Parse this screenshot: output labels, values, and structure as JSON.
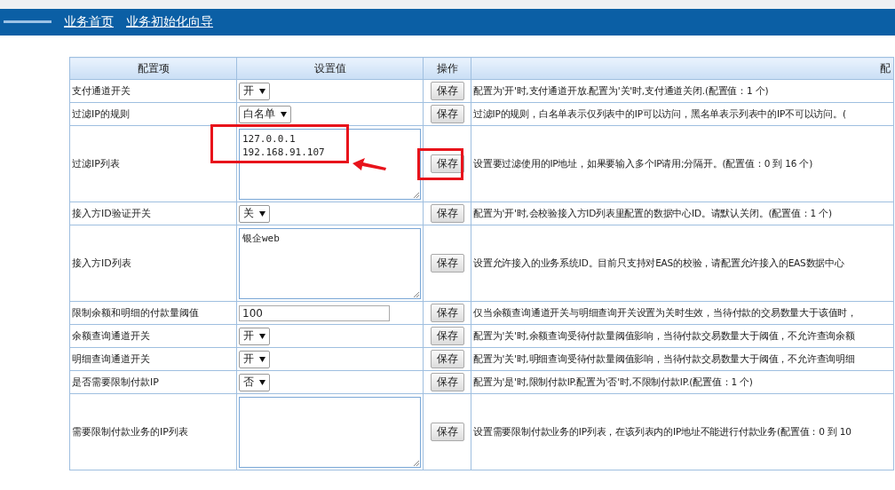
{
  "nav": {
    "links": [
      "业务首页",
      "业务初始化向导"
    ]
  },
  "table": {
    "columns": [
      "配置项",
      "设置值",
      "操作",
      "配"
    ],
    "rows": [
      {
        "name": "支付通道开关",
        "kind": "select",
        "value": "开",
        "button": "保存",
        "highlighted": false,
        "description": "配置为'开'时,支付通道开放.配置为'关'时,支付通道关闭.(配置值：1 个)"
      },
      {
        "name": "过滤IP的规则",
        "kind": "select",
        "value": "白名单",
        "button": "保存",
        "highlighted": false,
        "description": "过滤IP的规则，白名单表示仅列表中的IP可以访问，黑名单表示列表中的IP不可以访问。("
      },
      {
        "name": "过滤IP列表",
        "kind": "textarea",
        "value": "127.0.0.1\n192.168.91.107",
        "button": "保存",
        "highlighted": true,
        "description": "设置要过滤使用的IP地址，如果要输入多个IP请用;分隔开。(配置值：0 到 16 个)"
      },
      {
        "name": "接入方ID验证开关",
        "kind": "select",
        "value": "关",
        "button": "保存",
        "highlighted": false,
        "description": "配置为'开'时,会校验接入方ID列表里配置的数据中心ID。请默认关闭。(配置值：1 个)"
      },
      {
        "name": "接入方ID列表",
        "kind": "textarea",
        "value": "银企web",
        "button": "保存",
        "highlighted": false,
        "description": "设置允许接入的业务系统ID。目前只支持对EAS的校验，请配置允许接入的EAS数据中心"
      },
      {
        "name": "限制余额和明细的付款量阈值",
        "kind": "input",
        "value": "100",
        "button": "保存",
        "highlighted": false,
        "description": "仅当余额查询通道开关与明细查询开关设置为关时生效，当待付款的交易数量大于该值时，"
      },
      {
        "name": "余额查询通道开关",
        "kind": "select",
        "value": "开",
        "button": "保存",
        "highlighted": false,
        "description": "配置为'关'时,余额查询受待付款量阈值影响，当待付款交易数量大于阈值，不允许查询余额"
      },
      {
        "name": "明细查询通道开关",
        "kind": "select",
        "value": "开",
        "button": "保存",
        "highlighted": false,
        "description": "配置为'关'时,明细查询受待付款量阈值影响，当待付款交易数量大于阈值，不允许查询明细"
      },
      {
        "name": "是否需要限制付款IP",
        "kind": "select",
        "value": "否",
        "button": "保存",
        "highlighted": false,
        "description": "配置为'是'时,限制付款IP.配置为'否'时,不限制付款IP.(配置值：1 个)"
      },
      {
        "name": "需要限制付款业务的IP列表",
        "kind": "textarea",
        "value": "",
        "button": "保存",
        "highlighted": false,
        "description": "设置需要限制付款业务的IP列表，在该列表内的IP地址不能进行付款业务(配置值：0 到 10"
      }
    ]
  }
}
